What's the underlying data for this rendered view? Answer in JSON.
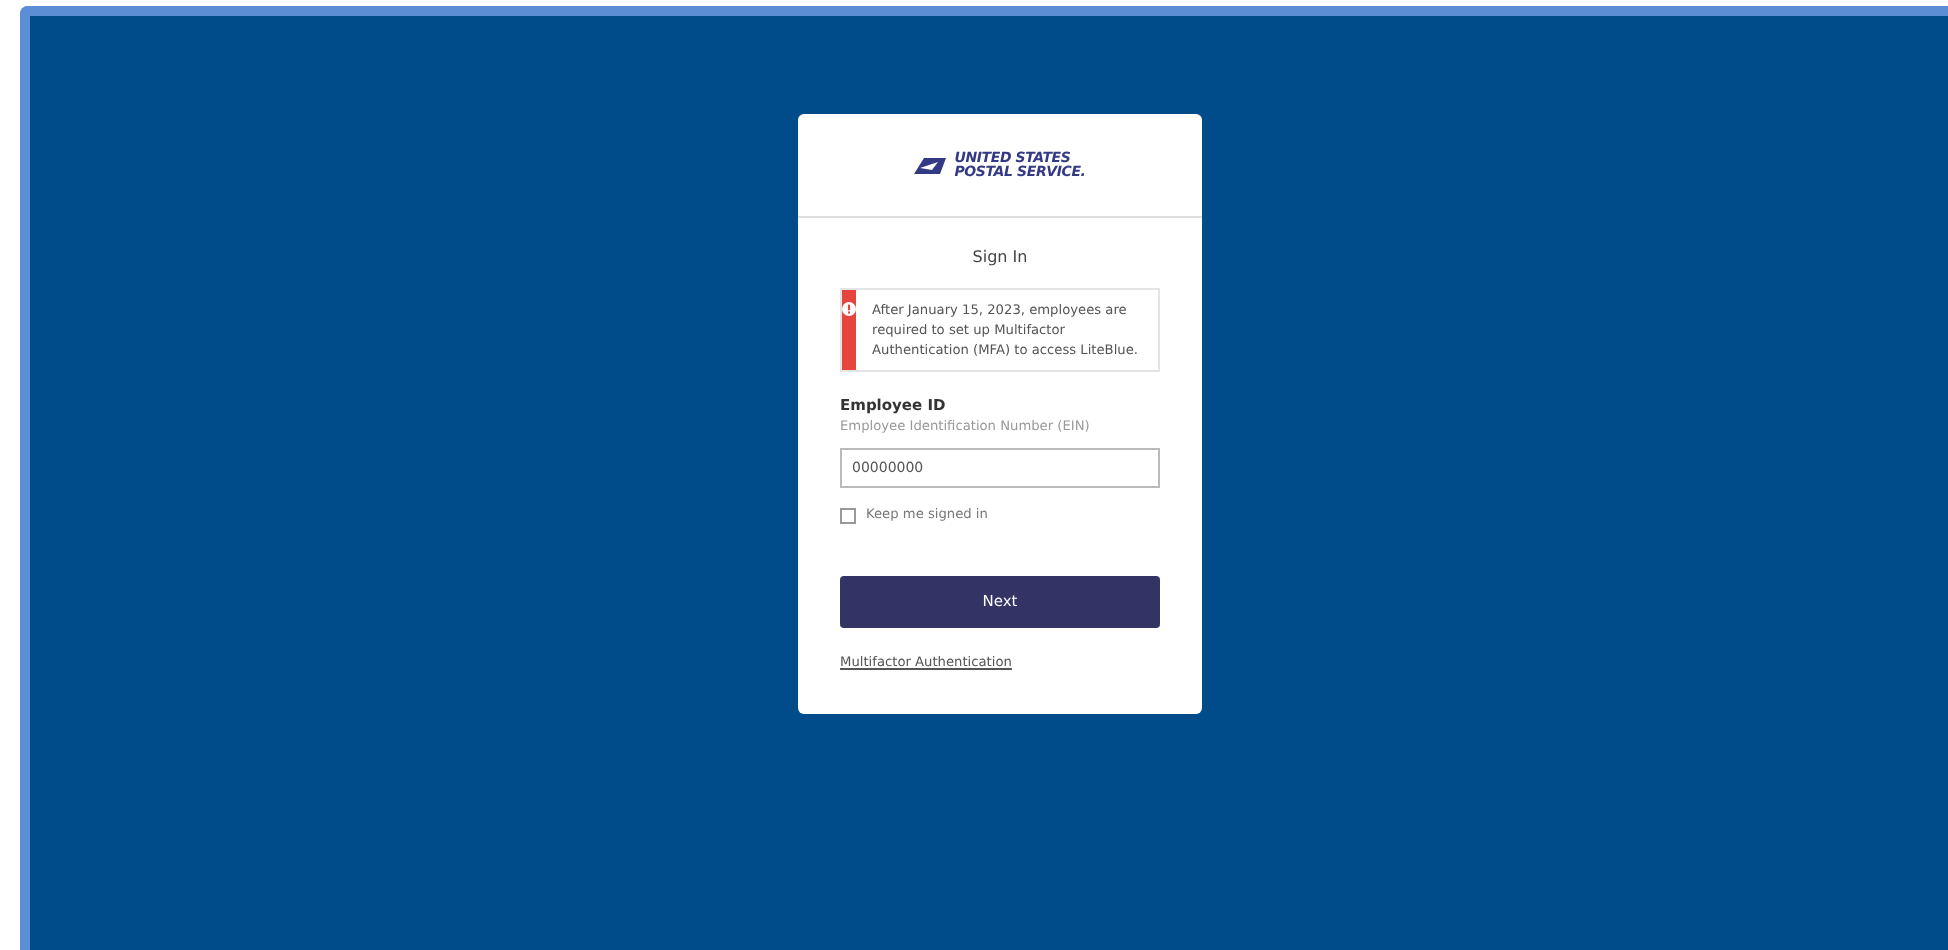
{
  "logo": {
    "lines": [
      "UNITED STATES",
      "POSTAL SERVICE."
    ]
  },
  "title": "Sign In",
  "alert": {
    "kind": "error",
    "text": "After January 15, 2023, employees are required to set up Multifactor Authentication (MFA) to access LiteBlue."
  },
  "field": {
    "label": "Employee ID",
    "hint": "Employee Identification Number (EIN)",
    "value": "00000000"
  },
  "remember": {
    "label": "Keep me signed in",
    "checked": false
  },
  "button": "Next",
  "link": "Multifactor Authentication"
}
